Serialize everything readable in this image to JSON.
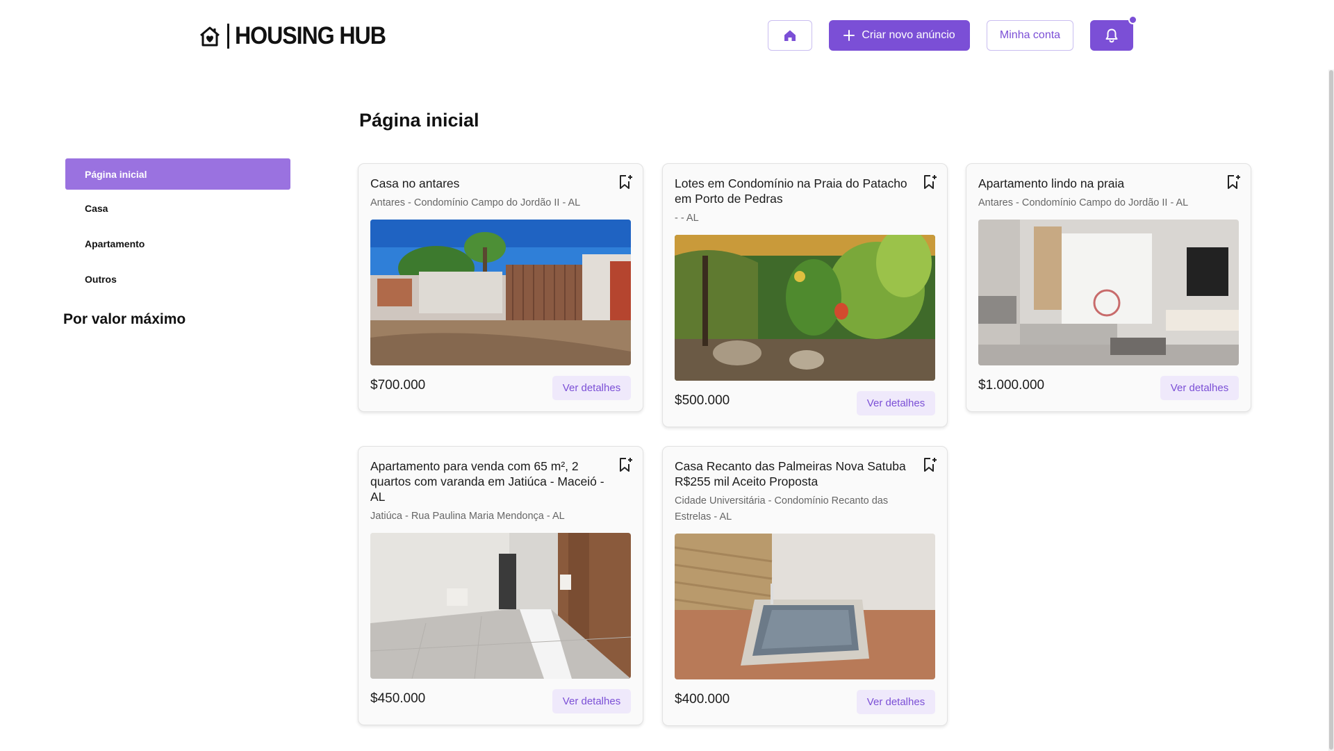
{
  "header": {
    "logo_text": "HOUSING HUB",
    "create_label": "Criar novo anúncio",
    "account_label": "Minha conta",
    "icons": {
      "home": "home-icon",
      "plus": "plus-icon",
      "bell": "bell-icon",
      "logo": "house-heart-icon"
    },
    "has_notification": true
  },
  "page_title": "Página inicial",
  "sidebar": {
    "items": [
      {
        "label": "Página inicial",
        "active": true
      },
      {
        "label": "Casa",
        "active": false
      },
      {
        "label": "Apartamento",
        "active": false
      },
      {
        "label": "Outros",
        "active": false
      }
    ],
    "filter_heading": "Por valor máximo"
  },
  "listings": [
    {
      "title": "Casa no antares",
      "location": "Antares - Condomínio Campo do Jordão II - AL",
      "price": "$700.000",
      "details_label": "Ver detalhes",
      "image": "street-house-photo"
    },
    {
      "title": "Lotes em Condomínio na Praia do Patacho em Porto de Pedras",
      "location": "- - AL",
      "price": "$500.000",
      "details_label": "Ver detalhes",
      "image": "garden-veranda-photo"
    },
    {
      "title": "Apartamento lindo na praia",
      "location": "Antares - Condomínio Campo do Jordão II - AL",
      "price": "$1.000.000",
      "details_label": "Ver detalhes",
      "image": "living-room-photo"
    },
    {
      "title": "Apartamento para venda com 65 m², 2 quartos com varanda em Jatiúca - Maceió - AL",
      "location": "Jatiúca - Rua Paulina Maria Mendonça - AL",
      "price": "$450.000",
      "details_label": "Ver detalhes",
      "image": "empty-room-photo"
    },
    {
      "title": "Casa Recanto das Palmeiras Nova Satuba R$255 mil Aceito Proposta",
      "location": "Cidade Universitária - Condomínio Recanto das Estrelas - AL",
      "price": "$400.000",
      "details_label": "Ver detalhes",
      "image": "plunge-pool-photo"
    }
  ],
  "colors": {
    "accent": "#7b4fd6",
    "accent_soft": "#efe9fb",
    "sidebar_active": "#9a72e0"
  }
}
